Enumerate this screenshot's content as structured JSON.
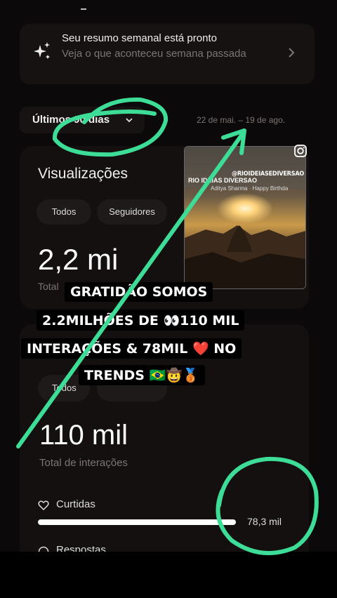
{
  "summary": {
    "title": "Seu resumo semanal está pronto",
    "subtitle": "Veja o que aconteceu semana passada"
  },
  "range": {
    "label": "Últimos 90 dias",
    "dates": "22 de mai. – 19 de ago."
  },
  "views": {
    "title": "Visualizações",
    "chip_all": "Todos",
    "chip_followers": "Seguidores",
    "value": "2,2 mi",
    "caption": "Total"
  },
  "thumbnail": {
    "handle": "@RIOIDEIASEDIVERSAO",
    "brand": "RIO IDEIAS DIVERSAO",
    "song": "Aditya Sharma · Happy Birthda"
  },
  "interactions": {
    "chip_all": "Todos",
    "value": "110 mil",
    "caption": "Total de interações",
    "likes_label": "Curtidas",
    "likes_value": "78,3 mil",
    "likes_fraction": 1.0,
    "replies_label": "Respostas"
  },
  "caption_overlay": [
    "GRATIDÃO SOMOS",
    "2.2MILHÕES DE 👀110 MIL",
    "INTERAÇÕES &  78MIL ❤️  NO",
    "TRENDS 🇧🇷🤠🥉"
  ],
  "annotation_color": "#3ddc97"
}
